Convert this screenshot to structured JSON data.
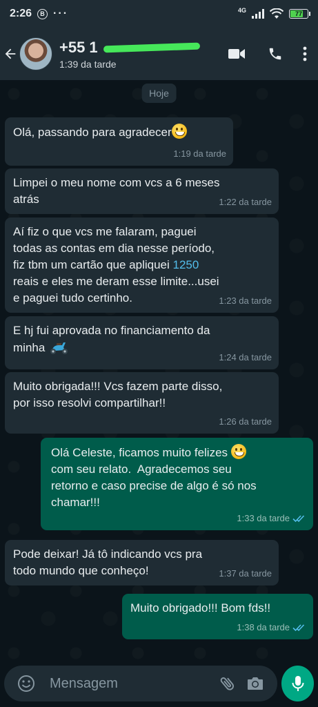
{
  "status_bar": {
    "time": "2:26",
    "badge": "B",
    "more_dots": "···",
    "network": "4G",
    "battery_level": "77"
  },
  "header": {
    "contact_name": "+55 1",
    "last_seen": "1:39 da tarde"
  },
  "chat": {
    "date_chip": "Hoje",
    "messages": [
      {
        "dir": "in",
        "parts": [
          {
            "t": "Olá, passando para agradecer"
          },
          {
            "emoji": "grinning-face"
          }
        ],
        "time": "1:19 da tarde"
      },
      {
        "dir": "in",
        "parts": [
          {
            "t": "Limpei o meu nome com vcs a 6 meses\natrás"
          }
        ],
        "time": "1:22 da tarde"
      },
      {
        "dir": "in",
        "parts": [
          {
            "t": "Aí fiz o que vcs me falaram, paguei\ntodas as contas em dia nesse período,\nfiz tbm um cartão que apliquei "
          },
          {
            "hl": "1250"
          },
          {
            "t": "\nreais e eles me deram esse limite...usei\ne paguei tudo certinho."
          }
        ],
        "time": "1:23 da tarde"
      },
      {
        "dir": "in",
        "parts": [
          {
            "t": "E hj fui aprovada no financiamento da\nminha "
          },
          {
            "emoji": "motor-scooter"
          }
        ],
        "time": "1:24 da tarde"
      },
      {
        "dir": "in",
        "parts": [
          {
            "t": "Muito obrigada!!! Vcs fazem parte disso,\npor isso resolvi compartilhar!!"
          }
        ],
        "time": "1:26 da tarde"
      },
      {
        "dir": "out",
        "parts": [
          {
            "t": "Olá Celeste, ficamos muito felizes "
          },
          {
            "emoji": "grinning-face"
          },
          {
            "t": "\ncom seu relato.  Agradecemos seu\nretorno e caso precise de algo é só nos\nchamar!!!"
          }
        ],
        "time": "1:33 da tarde",
        "read": true
      },
      {
        "dir": "in",
        "parts": [
          {
            "t": "Pode deixar! Já tô indicando vcs pra\ntodo mundo que conheço!"
          }
        ],
        "time": "1:37 da tarde"
      },
      {
        "dir": "out",
        "parts": [
          {
            "t": "Muito obrigado!!! Bom fds!!"
          }
        ],
        "time": "1:38 da tarde",
        "read": true
      }
    ]
  },
  "composer": {
    "placeholder": "Mensagem"
  },
  "colors": {
    "header_bg": "#1f2c34",
    "chat_bg": "#0b141a",
    "incoming_bubble": "#1f2c34",
    "outgoing_bubble": "#005c4b",
    "accent_green": "#00a884",
    "read_ticks": "#53bdeb"
  },
  "icons": [
    "back-arrow-icon",
    "video-call-icon",
    "phone-icon",
    "more-vert-icon",
    "emoji-icon",
    "attach-icon",
    "camera-icon",
    "mic-icon",
    "double-check-icon"
  ]
}
